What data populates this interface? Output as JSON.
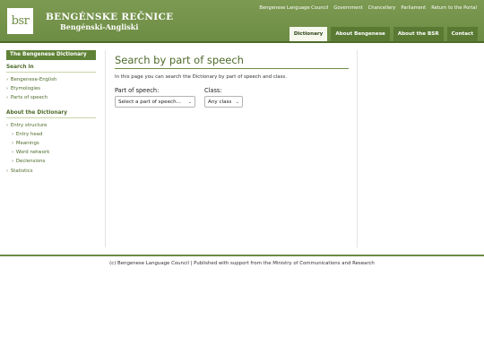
{
  "header": {
    "logo_text": "bsr",
    "title": "BENGÉNSKE REČNICE",
    "subtitle": "Bengénski-Angliski",
    "top_links": [
      "Bengenese Language Council",
      "Government",
      "Chancellery",
      "Parliament",
      "Return to the Portal"
    ],
    "tabs": [
      {
        "label": "Dictionary",
        "active": true
      },
      {
        "label": "About Bengenese",
        "active": false
      },
      {
        "label": "About the BSR",
        "active": false
      },
      {
        "label": "Contact",
        "active": false
      }
    ]
  },
  "sidebar": {
    "heading": "The Bengenese Dictionary",
    "search_title": "Search in",
    "search_items": [
      "Bengenese-English",
      "Etymologies",
      "Parts of speech"
    ],
    "about_title": "About the Dictionary",
    "about_items": [
      {
        "label": "Entry structure",
        "sub": false
      },
      {
        "label": "Entry head",
        "sub": true
      },
      {
        "label": "Meanings",
        "sub": true
      },
      {
        "label": "Word network",
        "sub": true
      },
      {
        "label": "Declensions",
        "sub": true
      },
      {
        "label": "Statistics",
        "sub": false
      }
    ]
  },
  "main": {
    "title": "Search by part of speech",
    "intro": "In this page you can search the Dictionary by part of speech and class.",
    "pos_label": "Part of speech:",
    "pos_value": "Select a part of speech...",
    "class_label": "Class:",
    "class_value": "Any class"
  },
  "footer": {
    "text": "(c) Bengenese Language Council | Published with support from the Ministry of Communications and Research"
  },
  "colors": {
    "brand_green": "#6d8c44",
    "dark_green": "#4e6b2a",
    "tab_green": "#5a7a34"
  },
  "icons": {
    "select_chevron": "chevron-down-icon",
    "bullet": "bullet-arrow-icon"
  }
}
